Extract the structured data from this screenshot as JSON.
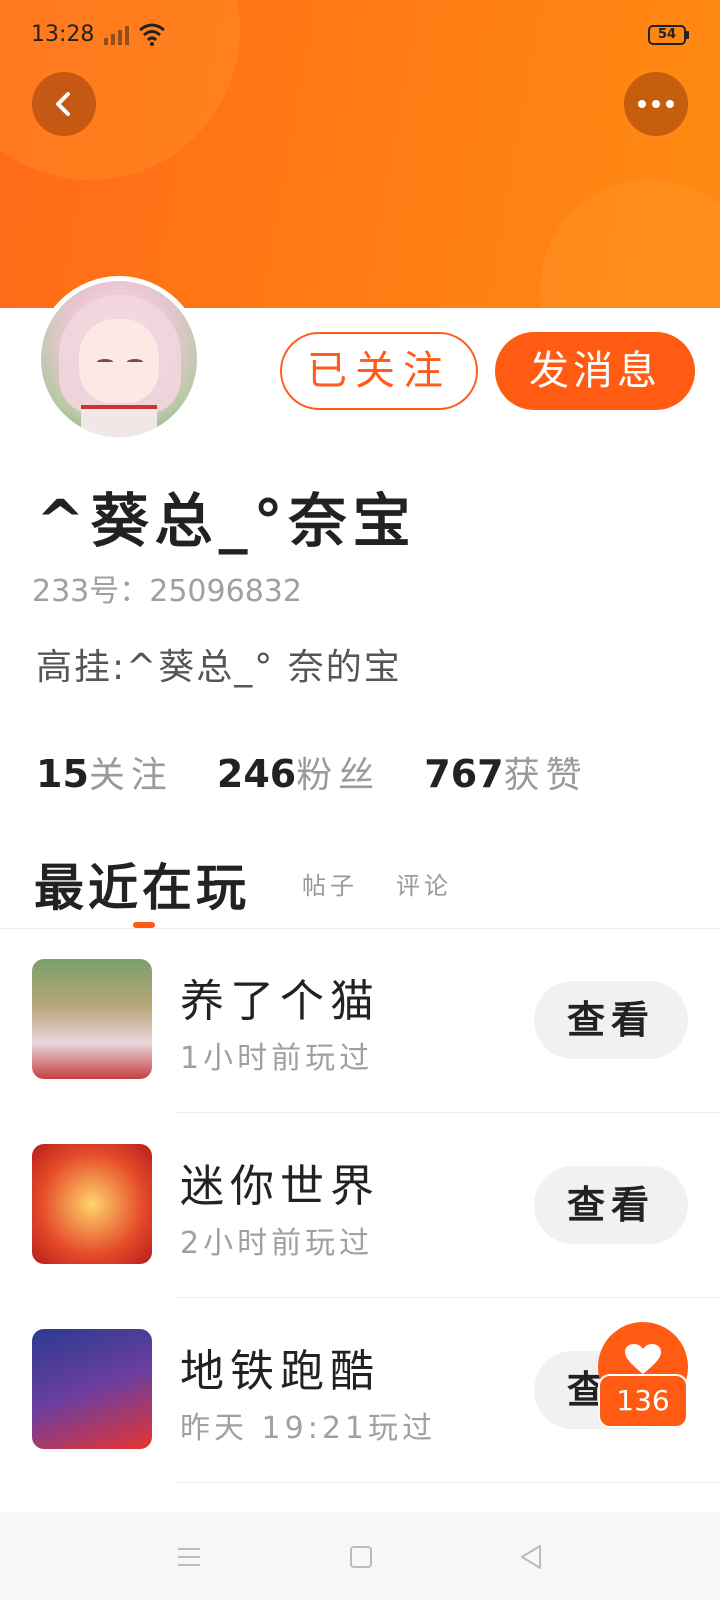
{
  "status_bar": {
    "time": "13:28",
    "battery": "54"
  },
  "profile": {
    "name": "^葵总_°奈宝",
    "id_text": "233号：25096832",
    "bio": "高挂:^葵总_° 奈的宝",
    "follow_button": "已关注",
    "message_button": "发消息"
  },
  "stats": [
    {
      "value": "15",
      "label": "关注"
    },
    {
      "value": "246",
      "label": "粉丝"
    },
    {
      "value": "767",
      "label": "获赞"
    }
  ],
  "tabs": {
    "active": "最近在玩",
    "posts": "帖子",
    "comments": "评论"
  },
  "games": [
    {
      "title": "养了个猫",
      "time": "1小时前玩过",
      "button": "查看",
      "icon": "game-cat-icon"
    },
    {
      "title": "迷你世界",
      "time": "2小时前玩过",
      "button": "查看",
      "icon": "game-mini-world-icon"
    },
    {
      "title": "地铁跑酷",
      "time": "昨天 19:21玩过",
      "button": "查看",
      "icon": "game-subway-icon"
    }
  ],
  "like_fab": {
    "count": "136"
  },
  "colors": {
    "accent": "#ff5b12",
    "header_gradient_start": "#ff6a1a",
    "header_gradient_end": "#ff8a12"
  }
}
